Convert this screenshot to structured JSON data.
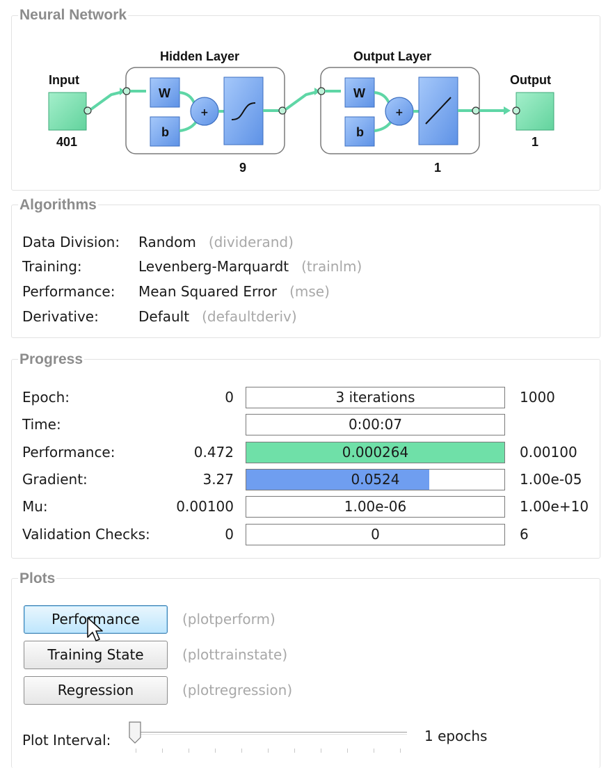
{
  "neural_network": {
    "title": "Neural Network",
    "input_label": "Input",
    "input_size": "401",
    "hidden_layer_label": "Hidden Layer",
    "hidden_size": "9",
    "output_layer_label": "Output Layer",
    "output_layer_size": "1",
    "output_label": "Output",
    "output_size": "1",
    "weight_symbol": "W",
    "bias_symbol": "b",
    "sum_symbol": "+"
  },
  "algorithms": {
    "title": "Algorithms",
    "rows": [
      {
        "label": "Data Division:",
        "value": "Random",
        "func": "(dividerand)"
      },
      {
        "label": "Training:",
        "value": "Levenberg-Marquardt",
        "func": "(trainlm)"
      },
      {
        "label": "Performance:",
        "value": "Mean Squared Error",
        "func": "(mse)"
      },
      {
        "label": "Derivative:",
        "value": "Default",
        "func": "(defaultderiv)"
      }
    ]
  },
  "progress": {
    "title": "Progress",
    "rows": [
      {
        "label": "Epoch:",
        "start": "0",
        "current": "3 iterations",
        "end": "1000",
        "fill": 0,
        "fill_color": ""
      },
      {
        "label": "Time:",
        "start": "",
        "current": "0:00:07",
        "end": "",
        "fill": 0,
        "fill_color": ""
      },
      {
        "label": "Performance:",
        "start": "0.472",
        "current": "0.000264",
        "end": "0.00100",
        "fill": 1.0,
        "fill_color": "#6fe0a8"
      },
      {
        "label": "Gradient:",
        "start": "3.27",
        "current": "0.0524",
        "end": "1.00e-05",
        "fill": 0.71,
        "fill_color": "#6f9ef0"
      },
      {
        "label": "Mu:",
        "start": "0.00100",
        "current": "1.00e-06",
        "end": "1.00e+10",
        "fill": 0,
        "fill_color": ""
      },
      {
        "label": "Validation Checks:",
        "start": "0",
        "current": "0",
        "end": "6",
        "fill": 0,
        "fill_color": ""
      }
    ]
  },
  "plots": {
    "title": "Plots",
    "buttons": [
      {
        "label": "Performance",
        "func": "(plotperform)",
        "active": true
      },
      {
        "label": "Training State",
        "func": "(plottrainstate)",
        "active": false
      },
      {
        "label": "Regression",
        "func": "(plotregression)",
        "active": false
      }
    ],
    "interval_label": "Plot Interval:",
    "interval_value": "1 epochs",
    "interval_position": 0
  },
  "colors": {
    "node_green": "#7fe0b0",
    "block_blue": "#79aaf0",
    "connector": "#5fd6a6",
    "perf_fill": "#6fe0a8",
    "grad_fill": "#6f9ef0"
  },
  "icons": [
    "transfer-sigmoid-icon",
    "transfer-linear-icon",
    "mouse-pointer-icon",
    "slider-thumb-icon"
  ]
}
